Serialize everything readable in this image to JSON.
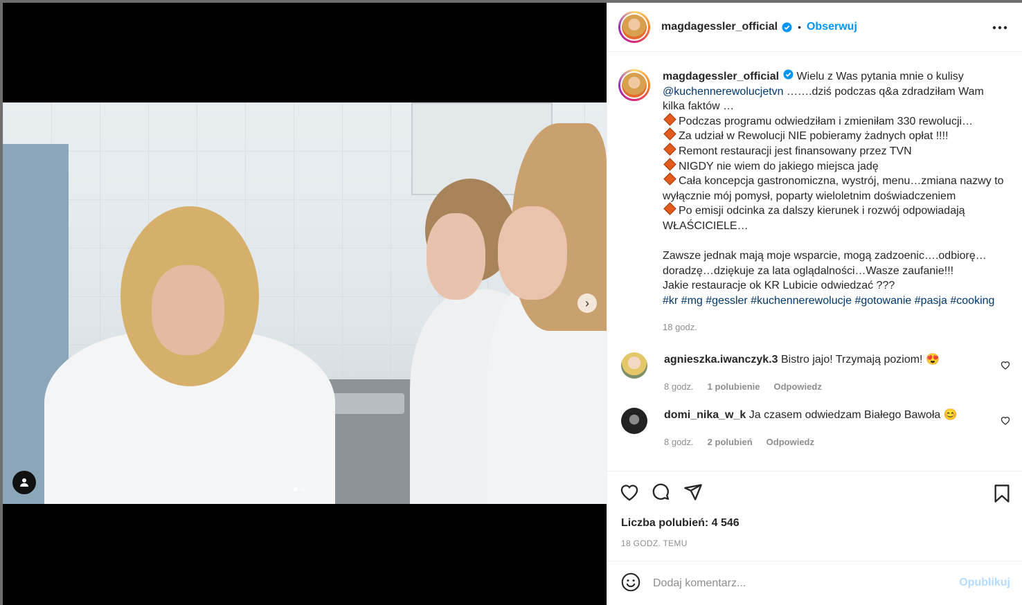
{
  "post": {
    "username": "magdagessler_official",
    "separator": "•",
    "follow_label": "Obserwuj",
    "more_label": "•••"
  },
  "caption": {
    "username": "magdagessler_official",
    "intro": "Wielu z Was pytania mnie o kulisy",
    "mention": "@kuchennerewolucjetvn",
    "intro_rest": "…….dziś podczas q&a zdradziłam Wam kilka faktów …",
    "facts": [
      "Podczas programu odwiedziłam i zmieniłam 330 rewolucji…",
      "Za udział w Rewolucji NIE pobieramy żadnych opłat !!!!",
      "Remont restauracji jest finansowany przez TVN",
      "NIGDY nie wiem do jakiego miejsca jadę",
      "Cała koncepcja gastronomiczna, wystrój, menu…zmiana nazwy to wyłącznie mój pomysł, poparty wieloletnim doświadczeniem",
      "Po emisji odcinka za dalszy kierunek i rozwój odpowiadają WŁAŚCICIELE…"
    ],
    "closing": "Zawsze jednak mają moje wsparcie, mogą zadzoenic….odbiorę…doradzę…dziękuje za lata oglądalności…Wasze zaufanie!!!",
    "question": "Jakie restauracje ok KR Lubicie odwiedzać ???",
    "hashtags": "#kr #mg #gessler #kuchennerewolucje #gotowanie #pasja #cooking",
    "time": "18 godz."
  },
  "comments": [
    {
      "username": "agnieszka.iwanczyk.3",
      "text": "Bistro jajo! Trzymają poziom! 😍",
      "time": "8 godz.",
      "likes": "1 polubienie",
      "reply": "Odpowiedz"
    },
    {
      "username": "domi_nika_w_k",
      "text": "Ja czasem odwiedzam Białego Bawoła 😊",
      "time": "8 godz.",
      "likes": "2 polubień",
      "reply": "Odpowiedz"
    }
  ],
  "likes_text": "Liczba polubień: 4 546",
  "time_ago": "18 GODZ. TEMU",
  "add_comment": {
    "placeholder": "Dodaj komentarz...",
    "publish_label": "Opublikuj"
  },
  "media": {
    "slides": 2,
    "active_slide": 1
  },
  "colors": {
    "link": "#00376b",
    "follow": "#0095f6",
    "verified": "#0095f6",
    "publish_disabled": "#b3dbff"
  },
  "icons": [
    "verified-icon",
    "more-options-icon",
    "chevron-right-icon",
    "user-tag-icon",
    "heart-icon",
    "comment-icon",
    "share-icon",
    "bookmark-icon",
    "emoji-icon"
  ]
}
